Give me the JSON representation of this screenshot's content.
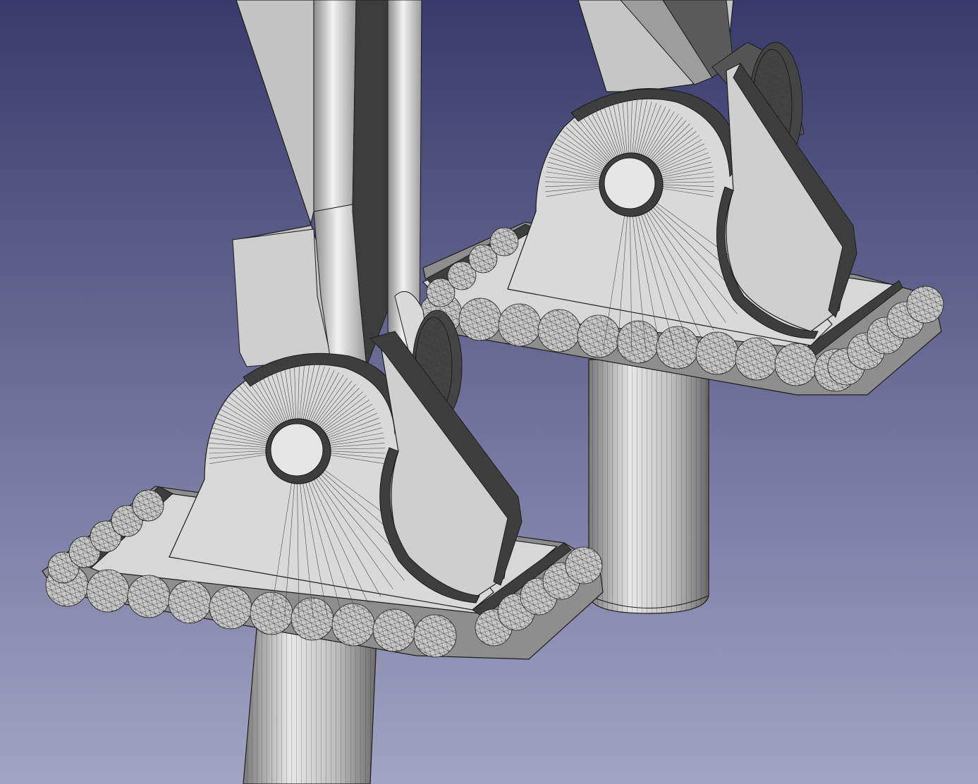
{
  "viewport": {
    "background_top": "#393a6b",
    "background_bottom": "#a3a3c4"
  },
  "colors": {
    "face_light": "#d2d2d2",
    "face_mid": "#b9b9b9",
    "face_dark": "#3e3e3e",
    "edge": "#1c1c1c",
    "mesh": "#4a4a4a"
  },
  "scene": {
    "objects": [
      {
        "name": "near-foot",
        "parts": [
          "leg-strut",
          "ankle-bracket",
          "pivot-hole",
          "foot-pad",
          "scalloped-pad-edge",
          "support-pin"
        ]
      },
      {
        "name": "far-foot",
        "parts": [
          "leg-strut",
          "ankle-bracket",
          "pivot-hole",
          "foot-pad",
          "scalloped-pad-edge",
          "support-pin"
        ]
      }
    ]
  }
}
